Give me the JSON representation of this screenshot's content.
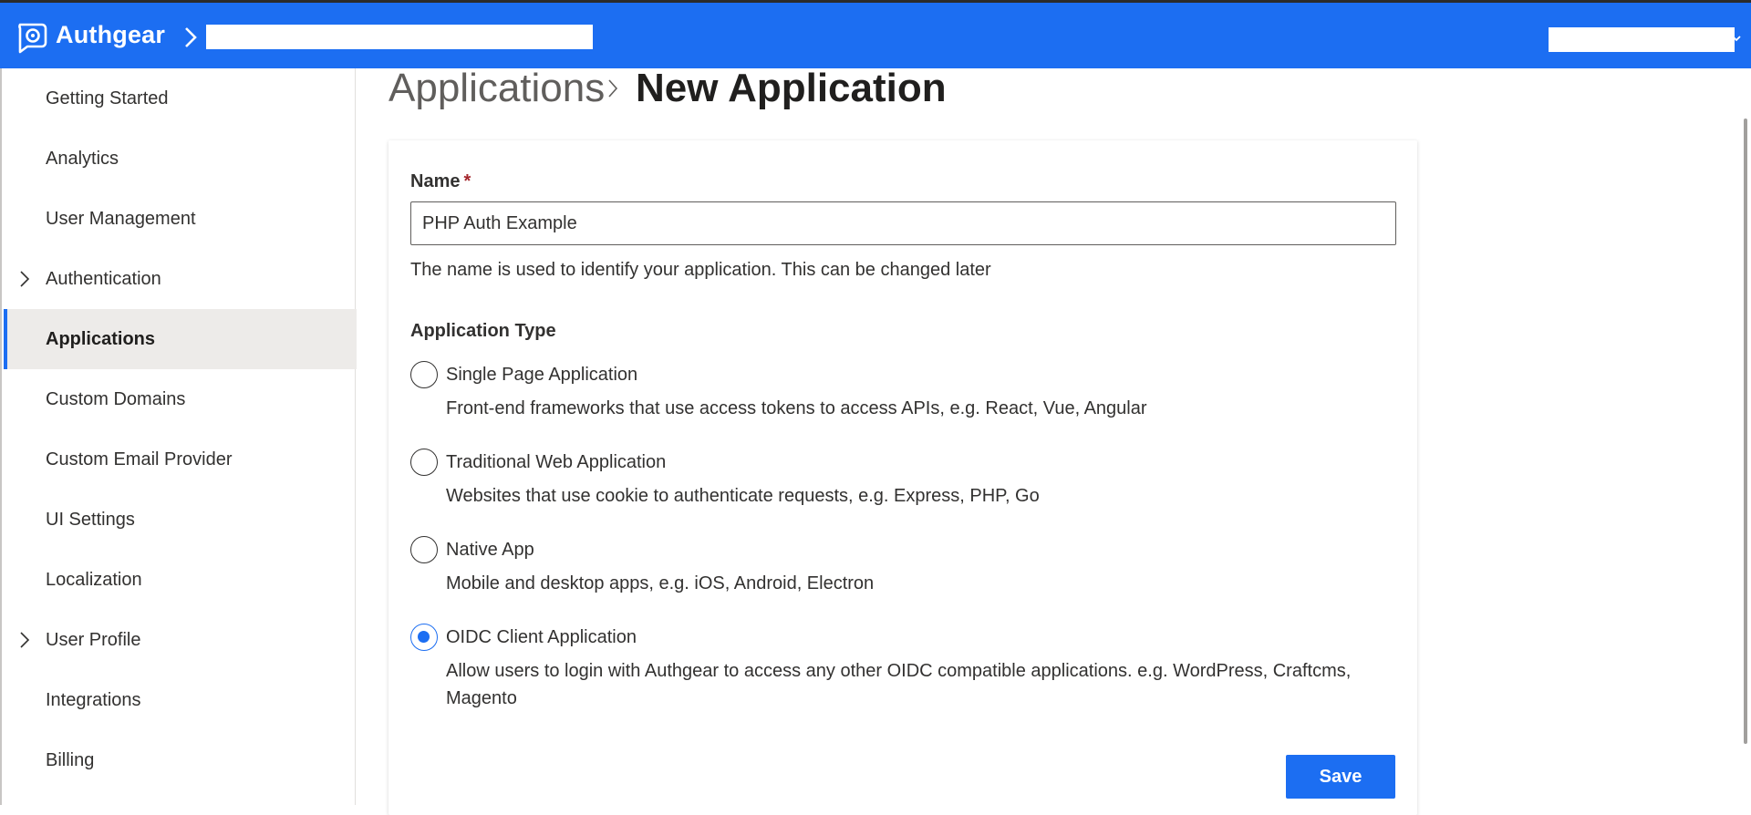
{
  "header": {
    "brand": "Authgear",
    "accent_color": "#1c6ef2"
  },
  "sidebar": {
    "items": [
      {
        "label": "Getting Started"
      },
      {
        "label": "Analytics"
      },
      {
        "label": "User Management"
      },
      {
        "label": "Authentication",
        "expandable": true
      },
      {
        "label": "Applications",
        "active": true
      },
      {
        "label": "Custom Domains"
      },
      {
        "label": "Custom Email Provider"
      },
      {
        "label": "UI Settings"
      },
      {
        "label": "Localization"
      },
      {
        "label": "User Profile",
        "expandable": true
      },
      {
        "label": "Integrations"
      },
      {
        "label": "Billing"
      }
    ]
  },
  "breadcrumb": {
    "root": "Applications",
    "current": "New Application"
  },
  "form": {
    "name_label": "Name",
    "required_mark": "*",
    "name_value": "PHP Auth Example",
    "name_hint": "The name is used to identify your application. This can be changed later",
    "type_label": "Application Type",
    "options": [
      {
        "title": "Single Page Application",
        "desc": "Front-end frameworks that use access tokens to access APIs, e.g. React, Vue, Angular",
        "checked": false
      },
      {
        "title": "Traditional Web Application",
        "desc": "Websites that use cookie to authenticate requests, e.g. Express, PHP, Go",
        "checked": false
      },
      {
        "title": "Native App",
        "desc": "Mobile and desktop apps, e.g. iOS, Android, Electron",
        "checked": false
      },
      {
        "title": "OIDC Client Application",
        "desc": "Allow users to login with Authgear to access any other OIDC compatible applications. e.g. WordPress, Craftcms, Magento",
        "checked": true
      }
    ],
    "save_label": "Save"
  }
}
